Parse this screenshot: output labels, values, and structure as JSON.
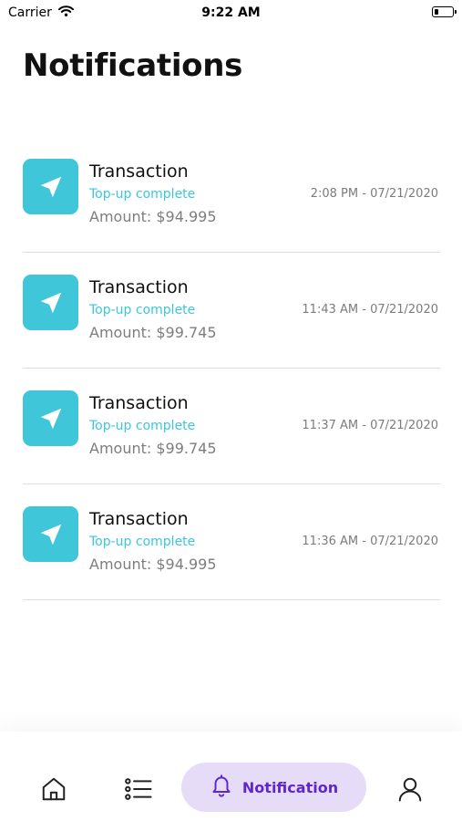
{
  "status_bar": {
    "carrier": "Carrier",
    "time": "9:22 AM",
    "battery_level": 0.2
  },
  "page": {
    "title": "Notifications"
  },
  "notifications": [
    {
      "title": "Transaction",
      "status": "Top-up complete",
      "amount": "Amount: $94.995",
      "time": "2:08 PM - 07/21/2020",
      "icon": "send-icon"
    },
    {
      "title": "Transaction",
      "status": "Top-up complete",
      "amount": "Amount: $99.745",
      "time": "11:43 AM - 07/21/2020",
      "icon": "send-icon"
    },
    {
      "title": "Transaction",
      "status": "Top-up complete",
      "amount": "Amount: $99.745",
      "time": "11:37 AM - 07/21/2020",
      "icon": "send-icon"
    },
    {
      "title": "Transaction",
      "status": "Top-up complete",
      "amount": "Amount: $94.995",
      "time": "11:36 AM - 07/21/2020",
      "icon": "send-icon"
    }
  ],
  "tab_bar": {
    "items": [
      {
        "icon": "home-icon",
        "active": false
      },
      {
        "icon": "list-icon",
        "active": false
      },
      {
        "icon": "bell-icon",
        "label": "Notification",
        "active": true
      },
      {
        "icon": "user-icon",
        "active": false
      }
    ]
  },
  "colors": {
    "accent": "#3fc6d9",
    "active_tab_bg": "#e6dcf8",
    "active_tab_text": "#5d27cf"
  }
}
